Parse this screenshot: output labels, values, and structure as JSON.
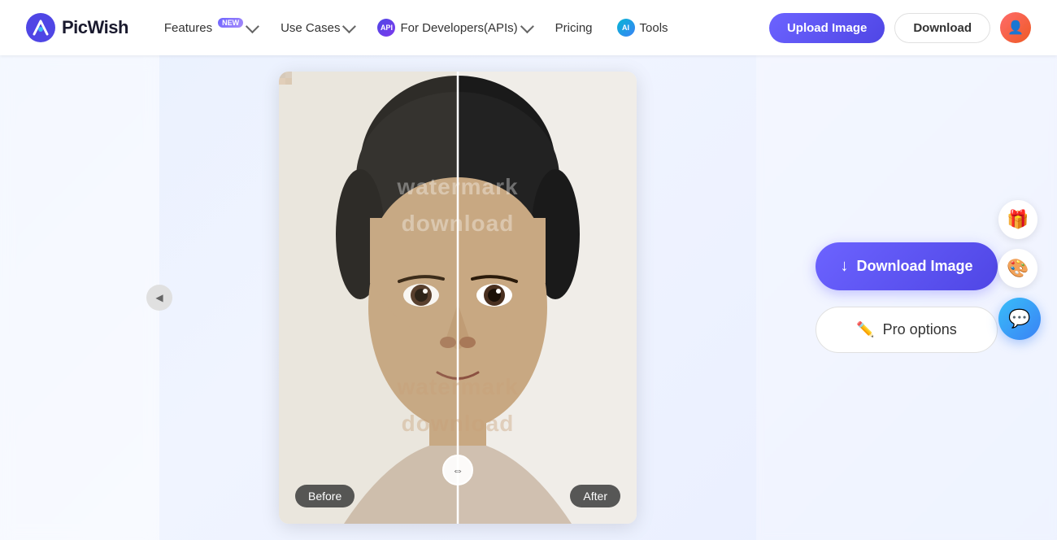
{
  "brand": {
    "name": "PicWish",
    "logo_color": "#4f46e5"
  },
  "navbar": {
    "features_label": "Features",
    "use_cases_label": "Use Cases",
    "for_developers_label": "For Developers(APIs)",
    "pricing_label": "Pricing",
    "tools_label": "Tools",
    "upload_button": "Upload Image",
    "download_button": "Download",
    "badge_new": "NEW"
  },
  "main": {
    "before_label": "Before",
    "after_label": "After",
    "watermark_line1": "watermark",
    "watermark_line2": "download"
  },
  "right_panel": {
    "download_image_label": "Download Image",
    "pro_options_label": "Pro options",
    "download_icon": "↓",
    "pro_icon": "✏"
  },
  "floating": {
    "gift_icon": "🎁",
    "art_icon": "🎨",
    "chat_icon": "💬"
  }
}
